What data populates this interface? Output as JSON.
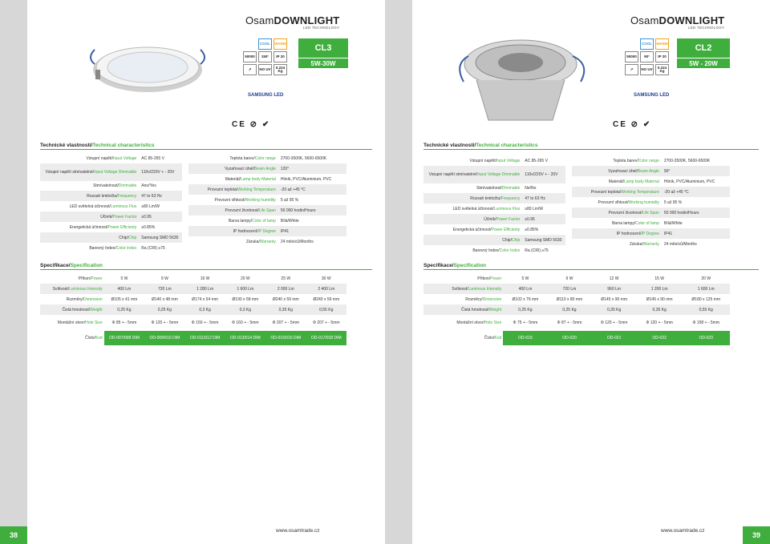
{
  "left": {
    "brand_normal": "Osam",
    "brand_bold": "DOWNLIGHT",
    "brand_sub": "LED TECHNOLOGY",
    "badges": [
      "COOL",
      "WARM",
      "50000",
      "150°",
      "IP 20",
      "NO UV",
      "0.224 Kg"
    ],
    "model_code": "CL3",
    "model_watt": "5W-30W",
    "samsung": "SAMSUNG LED",
    "cert": "CE ⊘ ✔",
    "tech_title_cz": "Technické vlastnosti/",
    "tech_title_en": "Technical characteristics",
    "tech_left": [
      {
        "cz": "Vstupní napětí/",
        "en": "Input Voltage",
        "v": "AC 85-265 V"
      },
      {
        "cz": "Vstupní napětí stmívatelné/",
        "en": "Input Voltage Dimmable",
        "v": "110v/220V + - 20V"
      },
      {
        "cz": "Stmívatelnost/",
        "en": "Dimmable",
        "v": "Ano/Yes"
      },
      {
        "cz": "Rozsah kmitočtu/",
        "en": "Frequency",
        "v": "47 to 63 Hz"
      },
      {
        "cz": "LED světelná účinnost/",
        "en": "Luminous Flux",
        "v": "≥80 Lm/W"
      },
      {
        "cz": "Účiník/",
        "en": "Power Factor",
        "v": "≥0.95"
      },
      {
        "cz": "Energetická účinnost/",
        "en": "Power Efficienty",
        "v": "≥0.85%"
      },
      {
        "cz": "Chip/",
        "en": "Chip",
        "v": "Samsung SMD 5630"
      },
      {
        "cz": "Barevný Index/",
        "en": "Color Index",
        "v": "Ra (CRI) ≥75"
      }
    ],
    "tech_right": [
      {
        "cz": "Teplota barev/",
        "en": "Color range",
        "v": "2700-3500K, 5600-6500K"
      },
      {
        "cz": "Vyzařovací úhel/",
        "en": "Beam Angle",
        "v": "120°"
      },
      {
        "cz": "Materiál/",
        "en": "Lamp body Material",
        "v": "Hliník, PVC/Aluminium, PVC"
      },
      {
        "cz": "Provozní teplota/",
        "en": "Working Temperature",
        "v": "-20 až +45 °C"
      },
      {
        "cz": "Provozní vlhkost/",
        "en": "Working humidity",
        "v": "5 až 95 %"
      },
      {
        "cz": "Provozní životnost/",
        "en": "Life Span",
        "v": "50 000 hodin/Hours"
      },
      {
        "cz": "Barva lampy/",
        "en": "Color of lamp",
        "v": "Bílá/White"
      },
      {
        "cz": "IP hodnocení/",
        "en": "IP Degree",
        "v": "IP41"
      },
      {
        "cz": "Záruka/",
        "en": "Warranty",
        "v": "24 měsíců/Months"
      }
    ],
    "spec_title_cz": "Specifikace/",
    "spec_title_en": "Specification",
    "spec_rows": [
      {
        "cz": "Příkon/",
        "en": "Power",
        "vals": [
          "5 W",
          "9 W",
          "16 W",
          "20 W",
          "25 W",
          "30 W"
        ]
      },
      {
        "cz": "Svítivost/",
        "en": "Luminous Intensity",
        "vals": [
          "400 Lm",
          "720 Lm",
          "1 280 Lm",
          "1 600 Lm",
          "2 000 Lm",
          "2 400 Lm"
        ]
      },
      {
        "cz": "Rozměry/",
        "en": "Dimension",
        "vals": [
          "Ø105 x 41 mm",
          "Ø140 x 48 mm",
          "Ø174 x 54 mm",
          "Ø190 x 58 mm",
          "Ø240 x 59 mm",
          "Ø240 x 59 mm"
        ]
      },
      {
        "cz": "Čistá hmotnost/",
        "en": "Weight",
        "vals": [
          "0,25 Kg",
          "0,25 Kg",
          "0,3 Kg",
          "0,3 Kg",
          "0,35 Kg",
          "0,55 Kg"
        ]
      },
      {
        "cz": "Montážní otvor/",
        "en": "Hole Size",
        "vals": [
          "Φ 85 + - 5mm",
          "Φ 120 + - 5mm",
          "Φ 150 + - 5mm",
          "Φ 160 + - 5mm",
          "Φ 207 + - 5mm",
          "Φ 207 + - 5mm"
        ]
      },
      {
        "cz": "Číslo/",
        "en": "Kod",
        "vals": [
          "OD-007/008 DIM",
          "OD-009/010 DIM",
          "OD-011/012 DIM",
          "OD-013/014 DIM",
          "OD-015/016 DIM",
          "OD-017/018 DIM"
        ]
      }
    ],
    "url": "www.osamtrade.cz",
    "page_number": "38"
  },
  "right": {
    "brand_normal": "Osam",
    "brand_bold": "DOWNLIGHT",
    "brand_sub": "LED TECHNOLOGY",
    "badges": [
      "COOL",
      "WARM",
      "50000",
      "90°",
      "IP 20",
      "NO UV",
      "0.224 Kg"
    ],
    "model_code": "CL2",
    "model_watt": "5W - 20W",
    "samsung": "SAMSUNG LED",
    "cert": "CE ⊘ ✔",
    "tech_title_cz": "Technické vlastnosti/",
    "tech_title_en": "Technical characteristics",
    "tech_left": [
      {
        "cz": "Vstupní napětí/",
        "en": "Input Voltage",
        "v": "AC 85-265 V"
      },
      {
        "cz": "Vstupní napětí stmívatelné/",
        "en": "Input Voltage Dimmable",
        "v": "110v/220V + - 20V"
      },
      {
        "cz": "Stmívatelnost/",
        "en": "Dimmable",
        "v": "Ne/No"
      },
      {
        "cz": "Rozsah kmitočtu/",
        "en": "Frequency",
        "v": "47 to 63 Hz"
      },
      {
        "cz": "LED světelná účinnost/",
        "en": "Luminous Flux",
        "v": "≥80 Lm/W"
      },
      {
        "cz": "Účiník/",
        "en": "Power Factor",
        "v": "≥0.95"
      },
      {
        "cz": "Energetická účinnost/",
        "en": "Power Efficienty",
        "v": "≥0.85%"
      },
      {
        "cz": "Chip/",
        "en": "Chip",
        "v": "Samsung SMD 5630"
      },
      {
        "cz": "Barevný Index/",
        "en": "Color Index",
        "v": "Ra (CRI) ≥75"
      }
    ],
    "tech_right": [
      {
        "cz": "Teplota barev/",
        "en": "Color range",
        "v": "2700-3500K, 5600-6500K"
      },
      {
        "cz": "Vyzařovací úhel/",
        "en": "Beam Angle",
        "v": "90°"
      },
      {
        "cz": "Materiál/",
        "en": "Lamp body Material",
        "v": "Hliník, PVC/Aluminium, PVC"
      },
      {
        "cz": "Provozní teplota/",
        "en": "Working Temperature",
        "v": "-20 až +45 °C"
      },
      {
        "cz": "Provozní vlhkost/",
        "en": "Working humidity",
        "v": "5 až 95 %"
      },
      {
        "cz": "Provozní životnost/",
        "en": "Life Span",
        "v": "50 000 hodin/Hours"
      },
      {
        "cz": "Barva lampy/",
        "en": "Color of lamp",
        "v": "Bílá/White"
      },
      {
        "cz": "IP hodnocení/",
        "en": "IP Degree",
        "v": "IP41"
      },
      {
        "cz": "Záruka/",
        "en": "Warranty",
        "v": "24 měsíců/Months"
      }
    ],
    "spec_title_cz": "Specifikace/",
    "spec_title_en": "Specification",
    "spec_rows": [
      {
        "cz": "Příkon/",
        "en": "Power",
        "vals": [
          "5 W",
          "9 W",
          "12 W",
          "15 W",
          "20 W"
        ]
      },
      {
        "cz": "Svítivost/",
        "en": "Luminous Intensity",
        "vals": [
          "400 Lm",
          "720 Lm",
          "960 Lm",
          "1 200 Lm",
          "1 600 Lm"
        ]
      },
      {
        "cz": "Rozměry/",
        "en": "Dimension",
        "vals": [
          "Ø102 x 76 mm",
          "Ø110 x 80 mm",
          "Ø145 x 90 mm",
          "Ø145 x 90 mm",
          "Ø180 x 125 mm"
        ]
      },
      {
        "cz": "Čistá hmotnost/",
        "en": "Weight",
        "vals": [
          "0,25 Kg",
          "0,25 Kg",
          "0,35 Kg",
          "0,35 Kg",
          "0,55 Kg"
        ]
      },
      {
        "cz": "Montážní otvor/",
        "en": "Hole Size",
        "vals": [
          "Φ 75 + - 5mm",
          "Φ 87 + - 5mm",
          "Φ 120 + - 5mm",
          "Φ 120 + - 5mm",
          "Φ 158 + - 5mm"
        ]
      },
      {
        "cz": "Číslo/",
        "en": "Kod",
        "vals": [
          "OD-019",
          "OD-020",
          "OD-021",
          "OD-022",
          "OD-023"
        ]
      }
    ],
    "url": "www.osamtrade.cz",
    "page_number": "39"
  },
  "colors": {
    "accent": "#3fae3d",
    "cool": "#3b93d4",
    "warm": "#f0a41d",
    "samsung": "#1b3f8f"
  }
}
